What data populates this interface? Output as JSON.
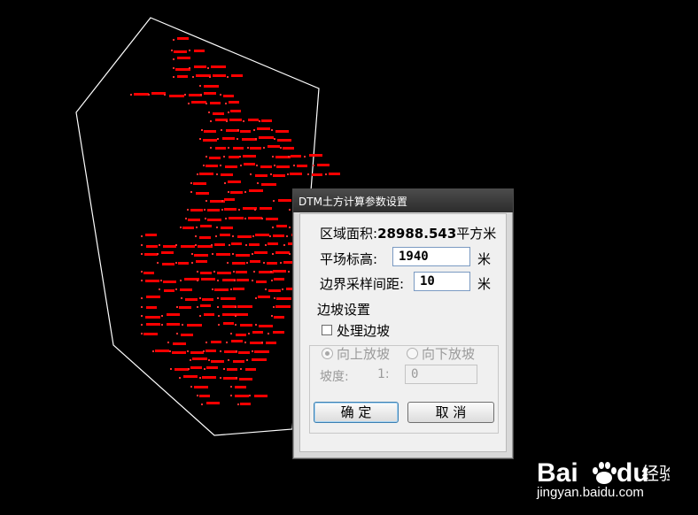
{
  "dialog": {
    "title": "DTM土方计算参数设置",
    "area_label": "区域面积:",
    "area_value": "28988.543",
    "area_unit": "平方米",
    "elev_label": "平场标高:",
    "elev_value": "1940",
    "elev_unit": "米",
    "sample_label": "边界采样间距:",
    "sample_value": "10",
    "sample_unit": "米",
    "slope_group": "边坡设置",
    "process_slope": "处理边坡",
    "slope_up": "向上放坡",
    "slope_down": "向下放坡",
    "slope_label": "坡度:",
    "slope_ratio": "1:",
    "slope_value": "0",
    "ok": "确 定",
    "cancel": "取 消"
  },
  "watermark": {
    "brand": "Bai",
    "brand2": "du",
    "suffix": "经验",
    "url": "jingyan.baidu.com"
  }
}
